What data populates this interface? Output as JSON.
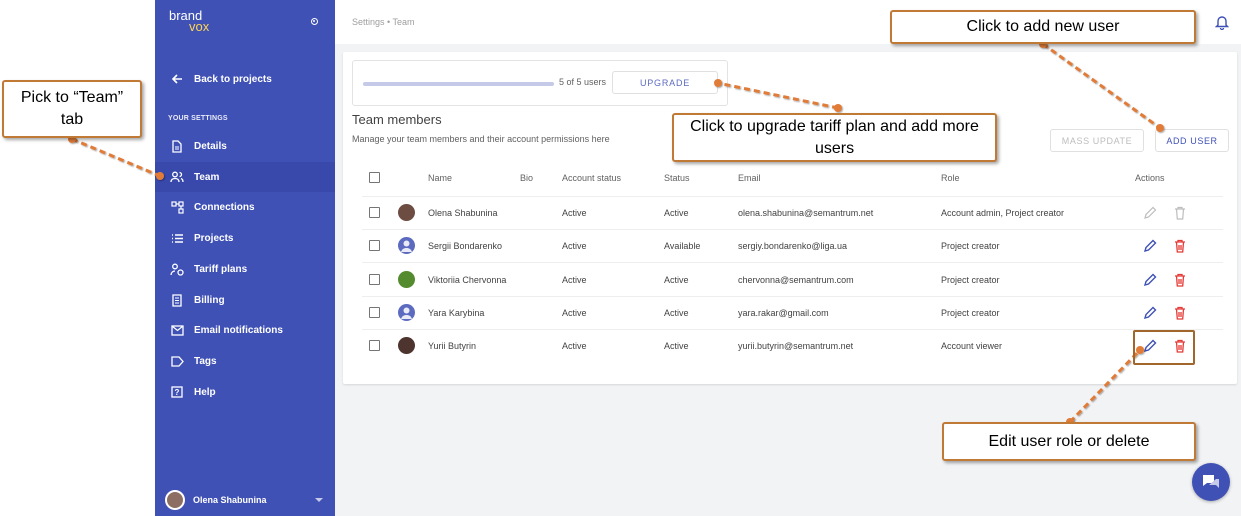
{
  "logo": {
    "line1": "brand",
    "line2": "vox"
  },
  "sidebar": {
    "back_label": "Back to projects",
    "section_label": "YOUR SETTINGS",
    "items": [
      {
        "label": "Details",
        "icon": "document-icon"
      },
      {
        "label": "Team",
        "icon": "team-icon",
        "active": true
      },
      {
        "label": "Connections",
        "icon": "connections-icon"
      },
      {
        "label": "Projects",
        "icon": "list-icon"
      },
      {
        "label": "Tariff plans",
        "icon": "tariff-icon"
      },
      {
        "label": "Billing",
        "icon": "receipt-icon"
      },
      {
        "label": "Email notifications",
        "icon": "mail-icon"
      },
      {
        "label": "Tags",
        "icon": "tag-icon"
      },
      {
        "label": "Help",
        "icon": "help-icon"
      }
    ],
    "user_name": "Olena Shabunina"
  },
  "breadcrumb": "Settings • Team",
  "usage": {
    "text": "5 of 5 users",
    "fraction": 1.0,
    "upgrade_label": "UPGRADE"
  },
  "team": {
    "title": "Team members",
    "subtitle": "Manage your team members and their account permissions here",
    "mass_update_label": "MASS UPDATE",
    "add_user_label": "ADD USER"
  },
  "table": {
    "headers": {
      "name": "Name",
      "bio": "Bio",
      "account_status": "Account status",
      "status": "Status",
      "email": "Email",
      "role": "Role",
      "actions": "Actions"
    },
    "rows": [
      {
        "name": "Olena Shabunina",
        "account_status": "Active",
        "status": "Active",
        "email": "olena.shabunina@semantrum.net",
        "role": "Account admin,  Project creator",
        "avatar": "photo",
        "editable": false
      },
      {
        "name": "Sergii Bondarenko",
        "account_status": "Active",
        "status": "Available",
        "email": "sergiy.bondarenko@liga.ua",
        "role": "Project creator",
        "avatar": "default",
        "editable": true
      },
      {
        "name": "Viktoriia Chervonna",
        "account_status": "Active",
        "status": "Active",
        "email": "chervonna@semantrum.com",
        "role": "Project creator",
        "avatar": "photo",
        "editable": true
      },
      {
        "name": "Yara Karybina",
        "account_status": "Active",
        "status": "Active",
        "email": "yara.rakar@gmail.com",
        "role": "Project creator",
        "avatar": "default",
        "editable": true
      },
      {
        "name": "Yurii Butyrin",
        "account_status": "Active",
        "status": "Active",
        "email": "yurii.butyrin@semantrum.net",
        "role": "Account viewer",
        "avatar": "photo",
        "editable": true
      }
    ]
  },
  "annotations": {
    "team_tab": "Pick to “Team” tab",
    "add_user": "Click to add new user",
    "upgrade": "Click to upgrade tariff plan and add more users",
    "edit_delete": "Edit user role or delete"
  },
  "colors": {
    "sidebar": "#3f51b5",
    "accent": "#3f51b5",
    "delete": "#e53935",
    "callout_border": "#c07a35",
    "arrow": "#e07b39"
  }
}
